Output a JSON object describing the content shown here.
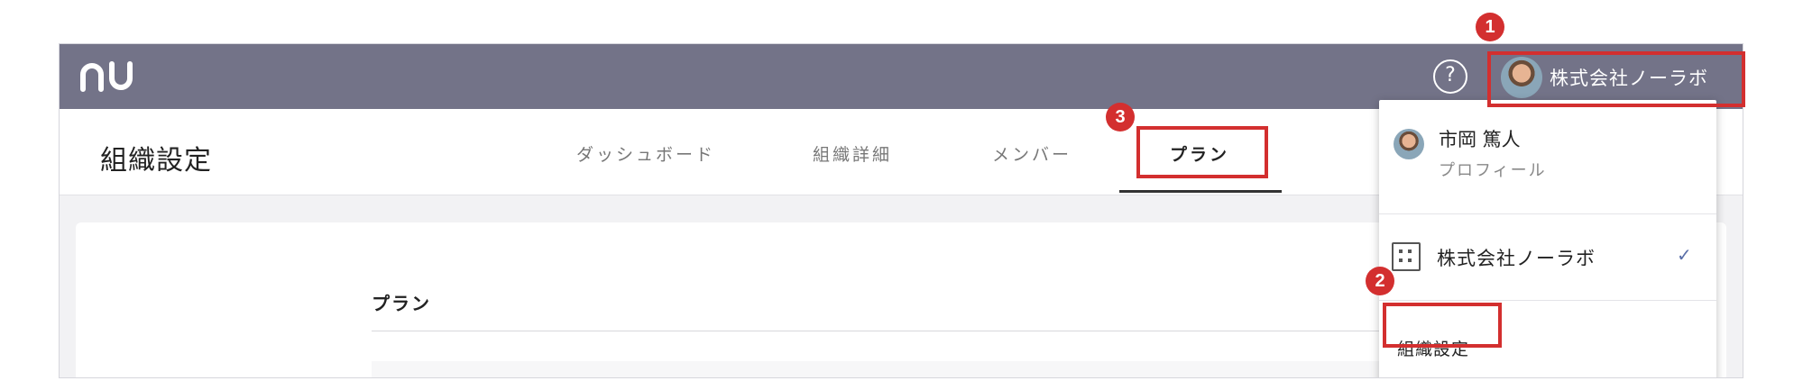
{
  "header": {
    "logo_text": "nu",
    "help_icon": "question-circle-icon",
    "account_name": "株式会社ノーラボ"
  },
  "subheader": {
    "title": "組織設定",
    "tabs": [
      {
        "label": "ダッシュボード"
      },
      {
        "label": "組織詳細"
      },
      {
        "label": "メンバー"
      },
      {
        "label": "プラン",
        "active": true
      }
    ]
  },
  "content": {
    "section_title": "プラン"
  },
  "dropdown": {
    "user_name": "市岡 篤人",
    "profile_label": "プロフィール",
    "org_name": "株式会社ノーラボ",
    "org_check": "✓",
    "settings_label": "組織設定"
  },
  "annotations": {
    "badges": [
      "1",
      "2",
      "3"
    ],
    "highlight_color": "#d32f2f"
  },
  "colors": {
    "topbar": "#737388",
    "check": "#5a6fa8"
  }
}
